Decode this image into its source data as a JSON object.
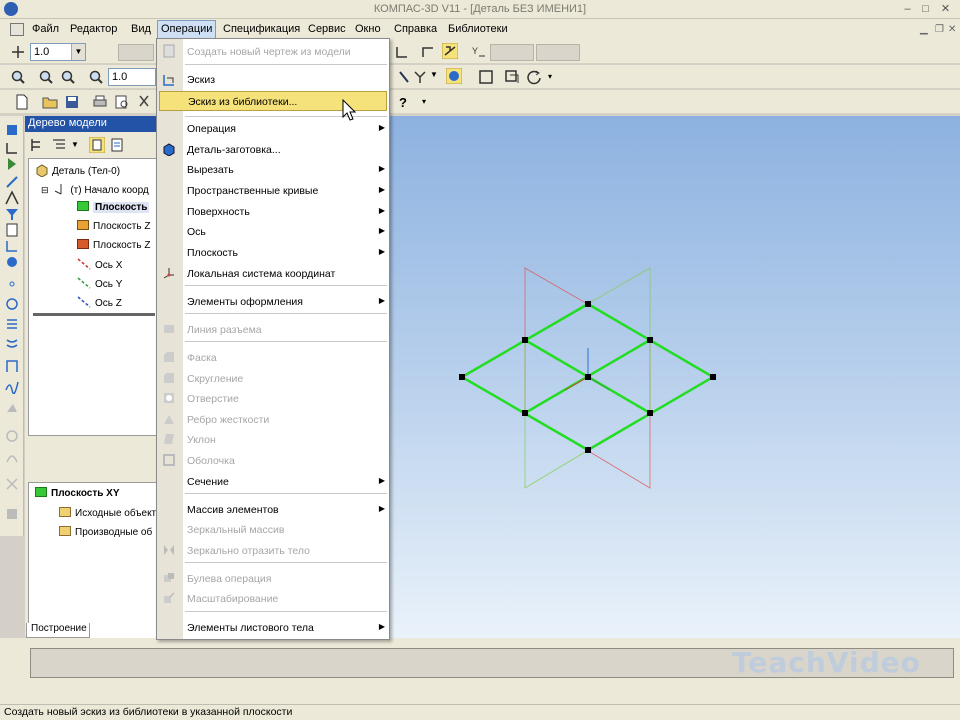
{
  "window": {
    "title": "КОМПАС-3D V11 - [Деталь БЕЗ ИМЕНИ1]"
  },
  "menubar": {
    "items": [
      "Файл",
      "Редактор",
      "Вид",
      "Операции",
      "Спецификация",
      "Сервис",
      "Окно",
      "Справка",
      "Библиотеки"
    ],
    "active": "Операции"
  },
  "toolbar": {
    "scale1": "1.0",
    "scale2": "1.0"
  },
  "tree": {
    "header": "Дерево модели",
    "nodes": [
      "Деталь (Тел-0)",
      "(т) Начало коорд",
      "Плоскость",
      "Плоскость Z",
      "Плоскость Z",
      "Ось X",
      "Ось Y",
      "Ось Z"
    ],
    "lower_title": "Плоскость XY",
    "lower_nodes": [
      "Исходные объекты",
      "Производные об"
    ],
    "tab": "Построение"
  },
  "menu": {
    "items": [
      {
        "label": "Создать новый чертеж из модели",
        "disabled": true,
        "submenu": false
      },
      {
        "label": "Эскиз",
        "disabled": false,
        "submenu": false
      },
      {
        "label": "Эскиз из библиотеки...",
        "disabled": false,
        "submenu": false,
        "highlighted": true
      },
      {
        "label": "Операция",
        "disabled": false,
        "submenu": true
      },
      {
        "label": "Деталь-заготовка...",
        "disabled": false,
        "submenu": false
      },
      {
        "label": "Вырезать",
        "disabled": false,
        "submenu": true
      },
      {
        "label": "Пространственные кривые",
        "disabled": false,
        "submenu": true
      },
      {
        "label": "Поверхность",
        "disabled": false,
        "submenu": true
      },
      {
        "label": "Ось",
        "disabled": false,
        "submenu": true
      },
      {
        "label": "Плоскость",
        "disabled": false,
        "submenu": true
      },
      {
        "label": "Локальная система координат",
        "disabled": false,
        "submenu": false
      },
      {
        "label": "Элементы оформления",
        "disabled": false,
        "submenu": true
      },
      {
        "label": "Линия разъема",
        "disabled": true,
        "submenu": false
      },
      {
        "label": "Фаска",
        "disabled": true,
        "submenu": false
      },
      {
        "label": "Скругление",
        "disabled": true,
        "submenu": false
      },
      {
        "label": "Отверстие",
        "disabled": true,
        "submenu": false
      },
      {
        "label": "Ребро жесткости",
        "disabled": true,
        "submenu": false
      },
      {
        "label": "Уклон",
        "disabled": true,
        "submenu": false
      },
      {
        "label": "Оболочка",
        "disabled": true,
        "submenu": false
      },
      {
        "label": "Сечение",
        "disabled": false,
        "submenu": true
      },
      {
        "label": "Массив элементов",
        "disabled": false,
        "submenu": true
      },
      {
        "label": "Зеркальный массив",
        "disabled": true,
        "submenu": false
      },
      {
        "label": "Зеркально отразить тело",
        "disabled": true,
        "submenu": false
      },
      {
        "label": "Булева операция",
        "disabled": true,
        "submenu": false
      },
      {
        "label": "Масштабирование",
        "disabled": true,
        "submenu": false
      },
      {
        "label": "Элементы листового тела",
        "disabled": false,
        "submenu": true
      }
    ]
  },
  "status": {
    "text": "Создать новый эскиз из библиотеки в указанной плоскости"
  },
  "watermark": "TeachVideo",
  "colors": {
    "accent_green": "#22dd22",
    "highlight": "#f5e27a",
    "tree_header": "#2353a7"
  }
}
